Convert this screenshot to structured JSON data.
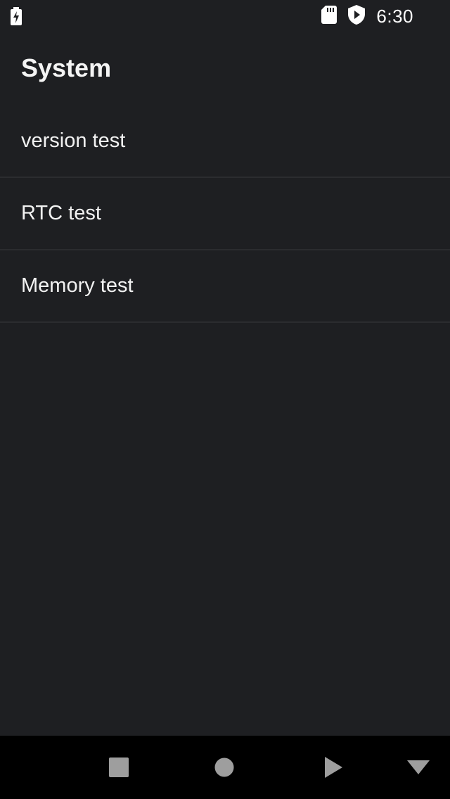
{
  "status_bar": {
    "time": "6:30",
    "icons": [
      "battery-charging-icon",
      "sd-card-icon",
      "shield-play-icon"
    ]
  },
  "app_bar": {
    "title": "System"
  },
  "list": {
    "items": [
      {
        "label": "version test"
      },
      {
        "label": "RTC test"
      },
      {
        "label": "Memory test"
      }
    ]
  },
  "nav_bar": {
    "buttons": [
      "stop-square-icon",
      "home-circle-icon",
      "play-triangle-icon",
      "dropdown-triangle-icon"
    ]
  },
  "colors": {
    "background": "#1e1f22",
    "nav_background": "#000000",
    "divider": "#2b2c2f",
    "nav_icon": "#9e9e9e"
  }
}
